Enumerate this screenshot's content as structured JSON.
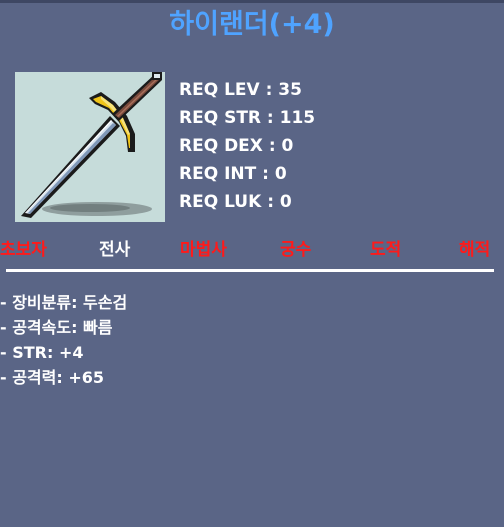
{
  "item": {
    "title": "하이랜더(+4)",
    "icon": "two-handed-sword-icon",
    "title_color": "#4fa3ff"
  },
  "requirements": [
    {
      "label": "REQ LEV : 35"
    },
    {
      "label": "REQ STR : 115"
    },
    {
      "label": "REQ DEX : 0"
    },
    {
      "label": "REQ INT : 0"
    },
    {
      "label": "REQ LUK : 0"
    }
  ],
  "jobs": [
    {
      "name": "초보자",
      "available": false
    },
    {
      "name": "전사",
      "available": true
    },
    {
      "name": "마법사",
      "available": false
    },
    {
      "name": "궁수",
      "available": false
    },
    {
      "name": "도적",
      "available": false
    },
    {
      "name": "해적",
      "available": false
    }
  ],
  "stats": [
    {
      "text": "- 장비분류: 두손검"
    },
    {
      "text": "- 공격속도: 빠름"
    },
    {
      "text": "- STR: +4"
    },
    {
      "text": "- 공격력: +65"
    }
  ],
  "colors": {
    "background": "#5a6586",
    "available_job": "#ffffff",
    "unavailable_job": "#ff1a1a"
  }
}
